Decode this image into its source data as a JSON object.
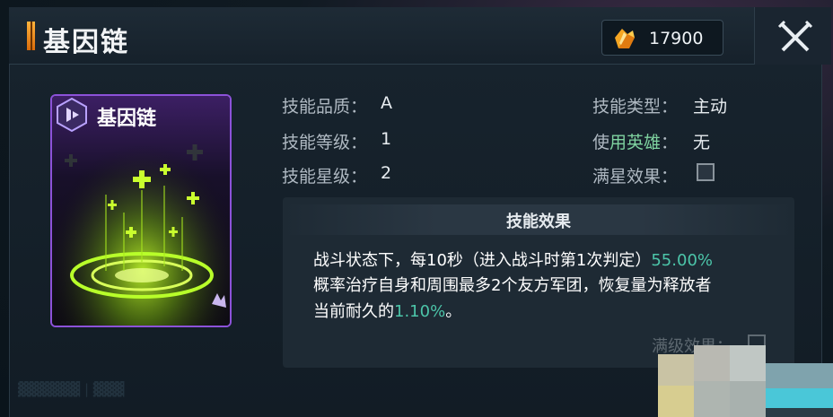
{
  "header": {
    "title": "基因链",
    "currency": {
      "icon": "crystal-icon",
      "value": "17900"
    },
    "close_icon": "crossed-swords-icon"
  },
  "card": {
    "name": "基因链",
    "emblem_icon": "hexagon-emblem-icon",
    "corner_icon": "rank-wing-icon"
  },
  "attributes": {
    "quality": {
      "label": "技能品质：",
      "value": "A"
    },
    "level": {
      "label": "技能等级：",
      "value": "1"
    },
    "star": {
      "label": "技能星级：",
      "value": "2"
    },
    "type": {
      "label": "技能类型：",
      "value": "主动"
    },
    "hero": {
      "label": "使用英雄：",
      "value": "无"
    },
    "full_star": {
      "label": "满星效果：",
      "checked": false
    }
  },
  "effect": {
    "title": "技能效果",
    "line1_text": "战斗状态下，每10秒（进入战斗时第1次判定）",
    "line1_highlight": "55.00%",
    "line2_text": "概率治疗自身和周围最多2个友方军团，恢复量为释放者",
    "line3_text": "当前耐久的",
    "line3_highlight": "1.10%",
    "line3_end": "。",
    "faded_label": "满级效果："
  },
  "colors": {
    "highlight": "#4cc5a9",
    "card_border": "#8c52d9",
    "accent_orange": "#f59a1f"
  }
}
